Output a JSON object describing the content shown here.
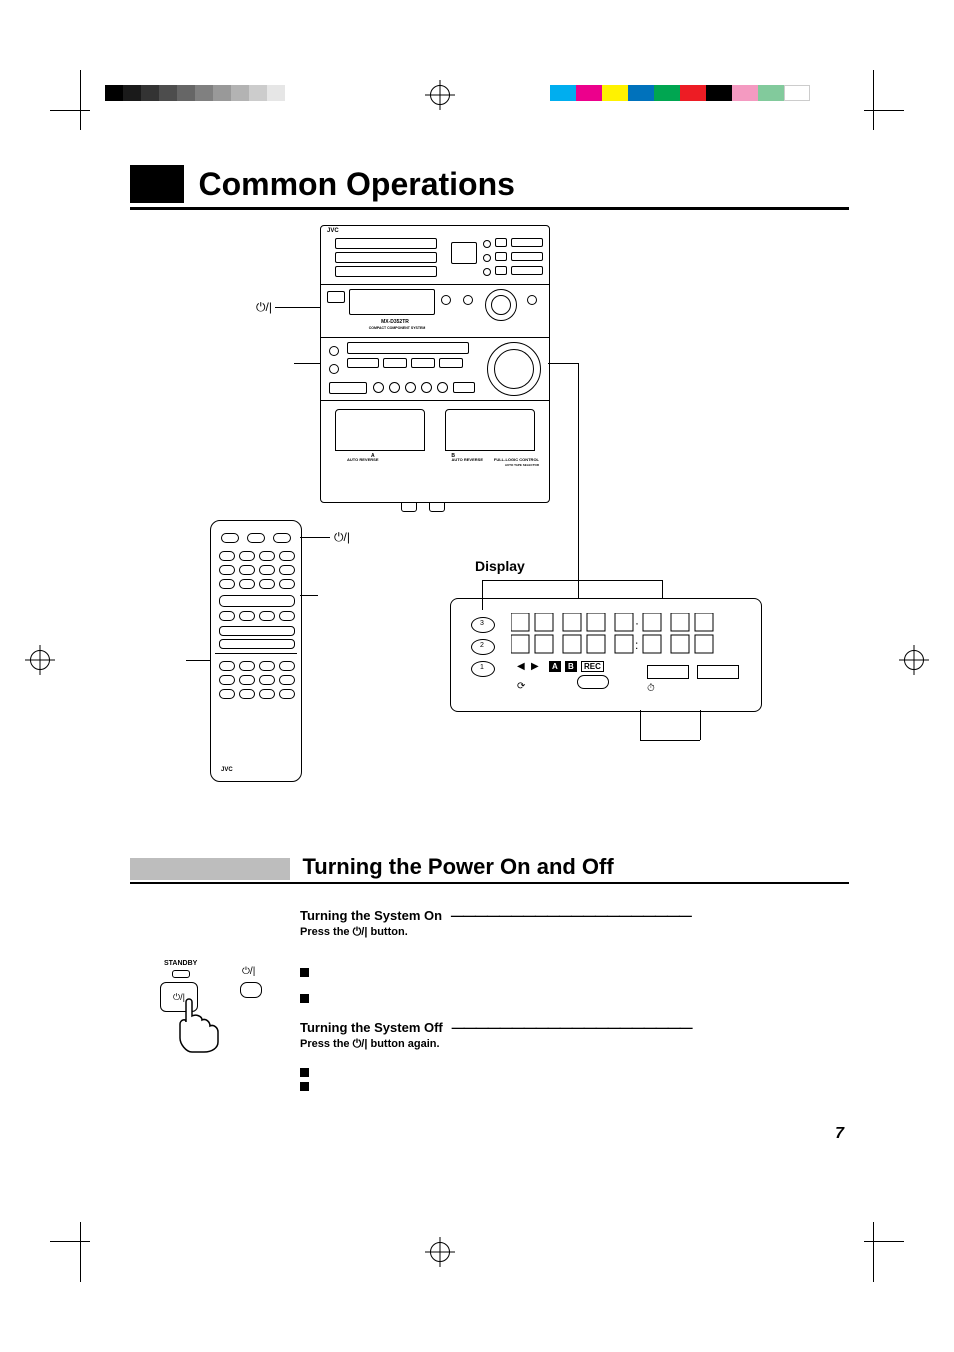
{
  "print_marks": {
    "gray_steps": [
      "#000000",
      "#1a1a1a",
      "#333333",
      "#4d4d4d",
      "#666666",
      "#808080",
      "#999999",
      "#b3b3b3",
      "#cccccc",
      "#e6e6e6"
    ],
    "color_steps": [
      "#00aeef",
      "#ec008c",
      "#fff200",
      "#0072bc",
      "#00a651",
      "#ed1c24",
      "#000000",
      "#f49ac1",
      "#82ca9c",
      "#ffffff"
    ]
  },
  "heading": "Common Operations",
  "stereo": {
    "brand": "JVC",
    "model": "MX-D352TR",
    "model_sub": "COMPACT COMPONENT SYSTEM",
    "power_symbol": "⏻/|",
    "labels": {
      "auto_reverse_a": "AUTO REVERSE",
      "auto_reverse_b": "AUTO REVERSE",
      "deck_a": "A",
      "deck_b": "B",
      "full_logic": "FULL-LOGIC CONTROL",
      "full_logic_sub": "AUTO TAPE SELECTOR"
    }
  },
  "remote": {
    "brand": "JVC",
    "power_symbol": "⏻/|"
  },
  "display": {
    "label": "Display",
    "indicators": {
      "a": "A",
      "b": "B",
      "rec": "REC"
    },
    "disc_nums": [
      "3",
      "2",
      "1"
    ]
  },
  "section": {
    "title": "Turning the Power On and Off",
    "on": {
      "heading": "Turning the System On",
      "instruction_pre": "Press the ",
      "symbol": "⏻/|",
      "instruction_post": " button."
    },
    "off": {
      "heading": "Turning the System Off",
      "instruction_pre": "Press the ",
      "symbol": "⏻/|",
      "instruction_post": " button again."
    }
  },
  "hand": {
    "standby": "STANDBY",
    "symbol": "⏻/|",
    "remote_symbol": "⏻/|"
  },
  "page_number": "7"
}
